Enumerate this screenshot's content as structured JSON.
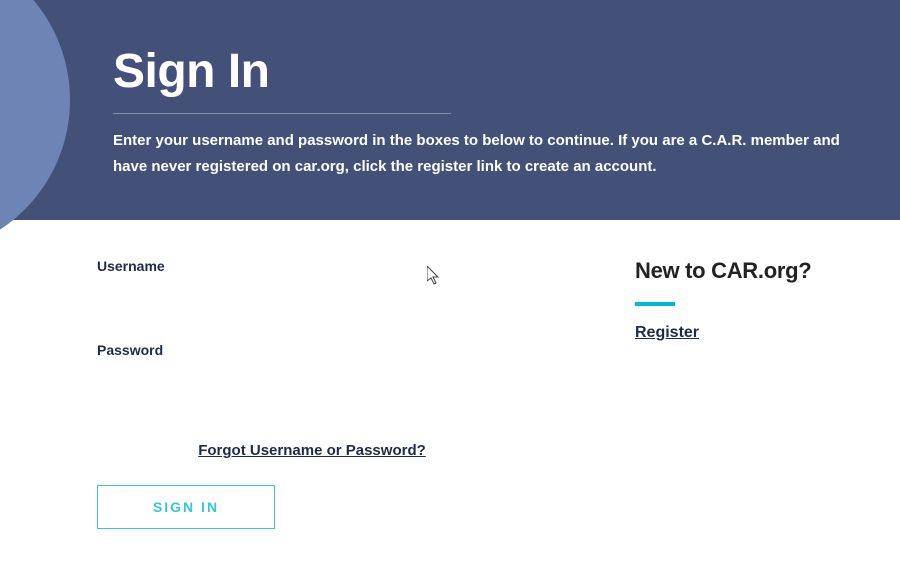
{
  "header": {
    "title": "Sign In",
    "instructions": "Enter your username and password in the boxes to below to continue. If you are a C.A.R. member and have never registered on car.org, click the register link to create an account."
  },
  "form": {
    "username_label": "Username",
    "username_value": "",
    "password_label": "Password",
    "password_value": "",
    "forgot_link": "Forgot Username or Password?",
    "signin_button": "SIGN IN"
  },
  "sidebar": {
    "heading": "New to CAR.org?",
    "register_link": "Register"
  }
}
